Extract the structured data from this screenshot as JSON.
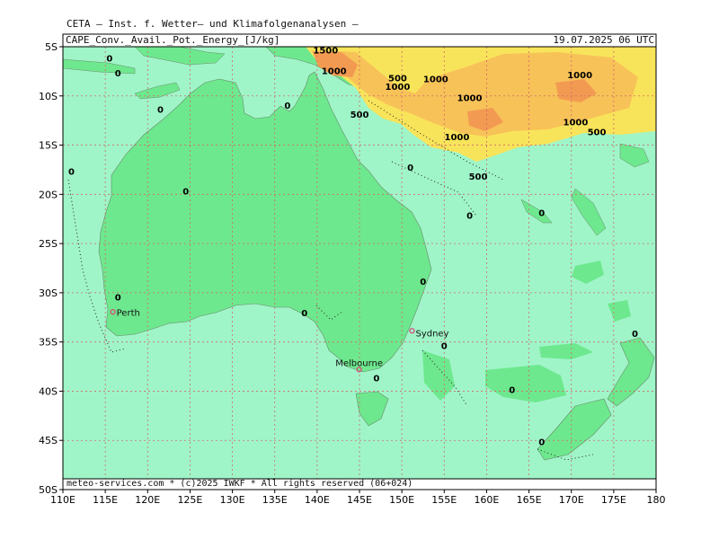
{
  "header": {
    "institute": "CETA — Inst. f. Wetter— und Klimafolgenanalysen —",
    "parameter": "CAPE_Conv._Avail._Pot._Energy_[J/kg]",
    "datetime": "19.07.2025 06 UTC",
    "footer": "meteo-services.com * (c)2025 IWKF * All rights reserved (06+024)"
  },
  "axes": {
    "lat_ticks": [
      "5S",
      "10S",
      "15S",
      "20S",
      "25S",
      "30S",
      "35S",
      "40S",
      "45S",
      "50S"
    ],
    "lon_ticks": [
      "110E",
      "115E",
      "120E",
      "125E",
      "130E",
      "135E",
      "140E",
      "145E",
      "150E",
      "155E",
      "160E",
      "165E",
      "170E",
      "175E",
      "180"
    ]
  },
  "colors": {
    "ocean": "#9ff5c8",
    "land": "#6ee88e",
    "cape_500": "#f8e45a",
    "cape_1000": "#f7c258",
    "cape_1500": "#f39a52",
    "grid": "#d06a6a",
    "city": "#e0407a"
  },
  "cities": [
    {
      "name": "Perth",
      "lon": 115.9,
      "lat": -31.95
    },
    {
      "name": "Sydney",
      "lon": 151.2,
      "lat": -33.87
    },
    {
      "name": "Melbourne",
      "lon": 144.96,
      "lat": -37.81
    }
  ],
  "contour_labels": [
    {
      "t": "0",
      "lon": 115.5,
      "lat": -6.5
    },
    {
      "t": "0",
      "lon": 116.5,
      "lat": -8.0
    },
    {
      "t": "0",
      "lon": 121.5,
      "lat": -11.7
    },
    {
      "t": "0",
      "lon": 111.0,
      "lat": -18.0
    },
    {
      "t": "0",
      "lon": 136.5,
      "lat": -11.3
    },
    {
      "t": "0",
      "lon": 124.5,
      "lat": -20.0
    },
    {
      "t": "0",
      "lon": 151.0,
      "lat": -17.6
    },
    {
      "t": "0",
      "lon": 158.0,
      "lat": -22.5
    },
    {
      "t": "0",
      "lon": 166.5,
      "lat": -22.2
    },
    {
      "t": "0",
      "lon": 152.5,
      "lat": -29.2
    },
    {
      "t": "0",
      "lon": 116.5,
      "lat": -30.8
    },
    {
      "t": "0",
      "lon": 138.5,
      "lat": -32.4
    },
    {
      "t": "0",
      "lon": 155.0,
      "lat": -35.7
    },
    {
      "t": "0",
      "lon": 147.0,
      "lat": -39.0
    },
    {
      "t": "0",
      "lon": 163.0,
      "lat": -40.2
    },
    {
      "t": "0",
      "lon": 177.5,
      "lat": -34.5
    },
    {
      "t": "0",
      "lon": 166.5,
      "lat": -45.5
    },
    {
      "t": "1500",
      "lon": 141.0,
      "lat": -5.7
    },
    {
      "t": "1000",
      "lon": 142.0,
      "lat": -7.8
    },
    {
      "t": "500",
      "lon": 149.5,
      "lat": -8.5
    },
    {
      "t": "1000",
      "lon": 149.5,
      "lat": -9.4
    },
    {
      "t": "1000",
      "lon": 154.0,
      "lat": -8.6
    },
    {
      "t": "500",
      "lon": 145.0,
      "lat": -12.2
    },
    {
      "t": "1000",
      "lon": 158.0,
      "lat": -10.5
    },
    {
      "t": "1000",
      "lon": 156.5,
      "lat": -14.5
    },
    {
      "t": "1000",
      "lon": 171.0,
      "lat": -8.2
    },
    {
      "t": "1000",
      "lon": 170.5,
      "lat": -13.0
    },
    {
      "t": "500",
      "lon": 173.0,
      "lat": -14.0
    },
    {
      "t": "500",
      "lon": 159.0,
      "lat": -18.5
    }
  ]
}
